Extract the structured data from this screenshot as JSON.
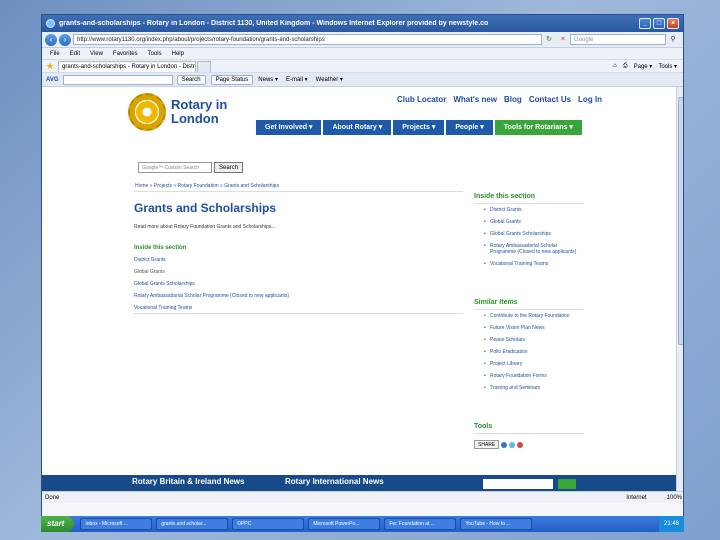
{
  "window": {
    "title": "grants-and-scholarships - Rotary in London - District 1130, United Kingdom - Windows Internet Explorer provided by newstyle.co",
    "url": "http://www.rotary1130.org/index.php/about/projects/rotary-foundation/grants-and-scholarships",
    "search_placeholder": "Google"
  },
  "menubar": [
    "File",
    "Edit",
    "View",
    "Favorites",
    "Tools",
    "Help"
  ],
  "favbar": {
    "tab_label": "grants-and-scholarships - Rotary in London - District 1...",
    "right_items": [
      "Page ▾",
      "Tools ▾"
    ]
  },
  "toolbar": {
    "avg": "AVG",
    "search_btn": "Search",
    "page_status": "Page Status",
    "items": [
      "News ▾",
      "E-mail ▾",
      "Weather ▾"
    ]
  },
  "site": {
    "logo_line1": "Rotary in",
    "logo_line2": "London",
    "top_links": [
      "Club Locator",
      "What's new",
      "Blog",
      "Contact Us",
      "Log In"
    ],
    "nav": [
      "Get Involved ▾",
      "About Rotary ▾",
      "Projects ▾",
      "People ▾",
      "Tools for Rotarians ▾"
    ],
    "search_placeholder": "Google™ Custom Search",
    "search_btn": "Search",
    "breadcrumb": "Home » Projects » Rotary Foundation » Grants and Scholarships",
    "heading": "Grants and Scholarships",
    "intro": "Read more about Rotary Foundation Grants and Scholarships...",
    "inside_heading": "Inside this section",
    "inside_links": [
      "District Grants",
      "Global Grants",
      "Global Grants Scholarships",
      "Rotary Ambassadorial Scholar Programme (Closed to new applicants)",
      "Vocational Training Teams"
    ],
    "sidebar": {
      "inside_heading": "Inside this section",
      "inside_links": [
        "District Grants",
        "Global Grants",
        "Global Grants Scholarships",
        "Rotary Ambassadorial Scholar Programme (Closed to new applicants)",
        "Vocational Training Teams"
      ],
      "similar_heading": "Similar Items",
      "similar_links": [
        "Contribute to the Rotary Foundation",
        "Future Vision Plan News",
        "Peace Scholars",
        "Polio Eradication",
        "Project Library",
        "Rotary Foundation Forms",
        "Training and Seminars"
      ],
      "tools_heading": "Tools",
      "share_label": "SHARE"
    },
    "footer": [
      "Rotary Britain & Ireland News",
      "Rotary International News"
    ]
  },
  "status": {
    "left": "Done",
    "zone": "Internet",
    "zoom": "100%"
  },
  "taskbar": {
    "start": "start",
    "buttons": [
      "Inbox - Microsoft ...",
      "grants and scholar...",
      "DPPC",
      "Microsoft PowerPo...",
      "Fw: Foundation at ...",
      "YouTube - How to ..."
    ],
    "clock": "21:48"
  }
}
